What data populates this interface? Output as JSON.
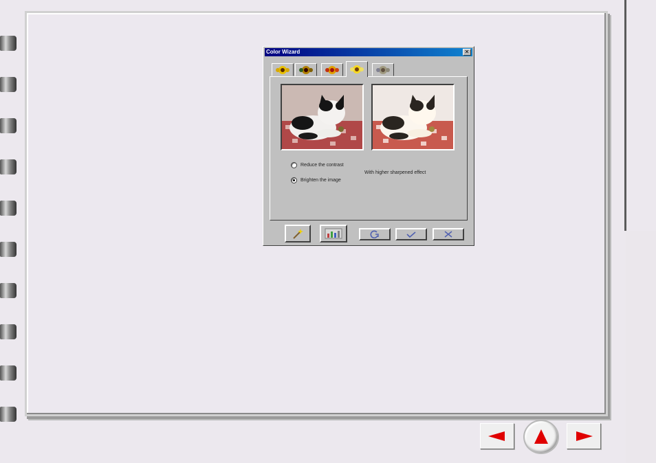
{
  "dialog": {
    "title": "Color Wizard",
    "close_label": "✕",
    "tabs": [
      {
        "icon": "sunflower-icon",
        "active": false
      },
      {
        "icon": "sunflower-dark-icon",
        "active": false
      },
      {
        "icon": "sunflower-red-icon",
        "active": false
      },
      {
        "icon": "sunflower-bright-icon",
        "active": true
      },
      {
        "icon": "sunflower-gray-icon",
        "active": false
      }
    ],
    "options": {
      "reduce_contrast_label": "Reduce the contrast",
      "reduce_contrast_selected": false,
      "brighten_label": "Brighten the image",
      "brighten_selected": true
    },
    "description": "With higher sharpened effect",
    "buttons": {
      "wand": "magic-wand-icon",
      "histogram": "histogram-icon",
      "reset": "reset-icon",
      "ok": "check-icon",
      "cancel": "x-icon"
    }
  },
  "navigation": {
    "prev": "left-arrow-icon",
    "home": "up-arrow-icon",
    "next": "right-arrow-icon"
  },
  "colors": {
    "titlebar": "#000080",
    "nav_arrow": "#e00000",
    "dialog_face": "#c0c0c0"
  }
}
